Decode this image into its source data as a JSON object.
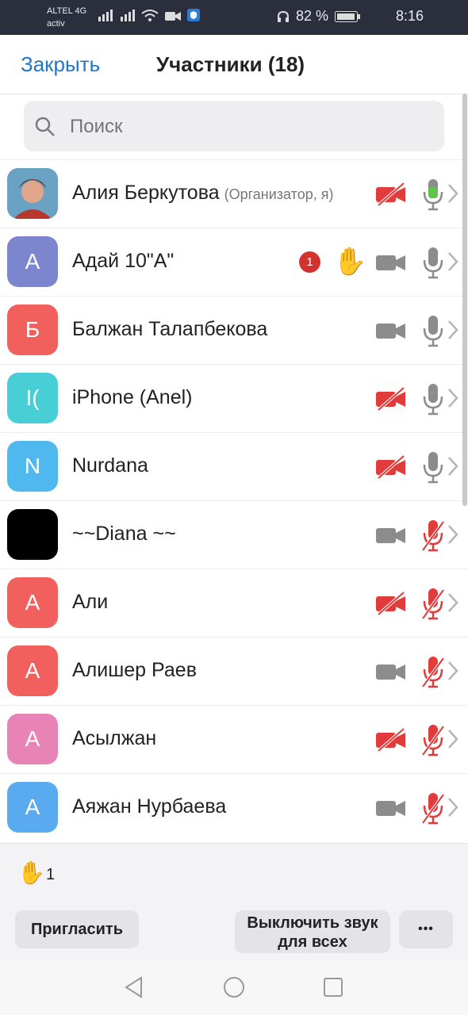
{
  "status_bar": {
    "carrier": "ALTEL 4G",
    "carrier_sub": "activ",
    "battery_percent": "82 %",
    "time": "8:16"
  },
  "header": {
    "close_label": "Закрыть",
    "title": "Участники (18)"
  },
  "search": {
    "placeholder": "Поиск"
  },
  "participants": [
    {
      "name": "Алия Беркутова",
      "role": "(Организатор, я)",
      "initial": "",
      "avatar_color": "#c96b4f",
      "photo": true,
      "video_off": true,
      "mic": "active",
      "hand": false
    },
    {
      "name": "Адай 10\"А\"",
      "role": "",
      "initial": "А",
      "avatar_color": "#7b86cf",
      "photo": false,
      "video_off": false,
      "mic": "on",
      "hand": true,
      "badge": "1"
    },
    {
      "name": "Балжан Талапбекова",
      "role": "",
      "initial": "Б",
      "avatar_color": "#f2605e",
      "photo": false,
      "video_off": false,
      "mic": "on",
      "hand": false
    },
    {
      "name": "iPhone (Anel)",
      "role": "",
      "initial": "I(",
      "avatar_color": "#48cfd6",
      "photo": false,
      "video_off": true,
      "mic": "on",
      "hand": false
    },
    {
      "name": "Nurdana",
      "role": "",
      "initial": "N",
      "avatar_color": "#4fb8ee",
      "photo": false,
      "video_off": true,
      "mic": "on",
      "hand": false
    },
    {
      "name": "~~Diana ~~",
      "role": "",
      "initial": "",
      "avatar_color": "#000000",
      "photo": false,
      "video_off": false,
      "mic": "muted",
      "hand": false
    },
    {
      "name": "Али",
      "role": "",
      "initial": "А",
      "avatar_color": "#f2605e",
      "photo": false,
      "video_off": true,
      "mic": "muted",
      "hand": false
    },
    {
      "name": "Алишер Раев",
      "role": "",
      "initial": "А",
      "avatar_color": "#f2605e",
      "photo": false,
      "video_off": false,
      "mic": "muted",
      "hand": false
    },
    {
      "name": "Асылжан",
      "role": "",
      "initial": "А",
      "avatar_color": "#e884b5",
      "photo": false,
      "video_off": true,
      "mic": "muted",
      "hand": false
    },
    {
      "name": "Аяжан Нурбаева",
      "role": "",
      "initial": "А",
      "avatar_color": "#5aaaf0",
      "photo": false,
      "video_off": false,
      "mic": "muted",
      "hand": false
    }
  ],
  "footer": {
    "raised_hands_count": "1",
    "invite_label": "Пригласить",
    "mute_all_label": "Выключить звук для всех",
    "more_label": "•••"
  },
  "colors": {
    "accent": "#1d76c7",
    "muted_red": "#e23b3b",
    "mic_active": "#5ec44a",
    "icon_gray": "#8c8c8c"
  },
  "icons": {
    "camera": "video-camera-icon",
    "camera_off": "video-camera-off-icon",
    "mic": "microphone-icon",
    "mic_off": "microphone-muted-icon",
    "hand": "raised-hand-icon",
    "chevron": "chevron-right-icon"
  }
}
